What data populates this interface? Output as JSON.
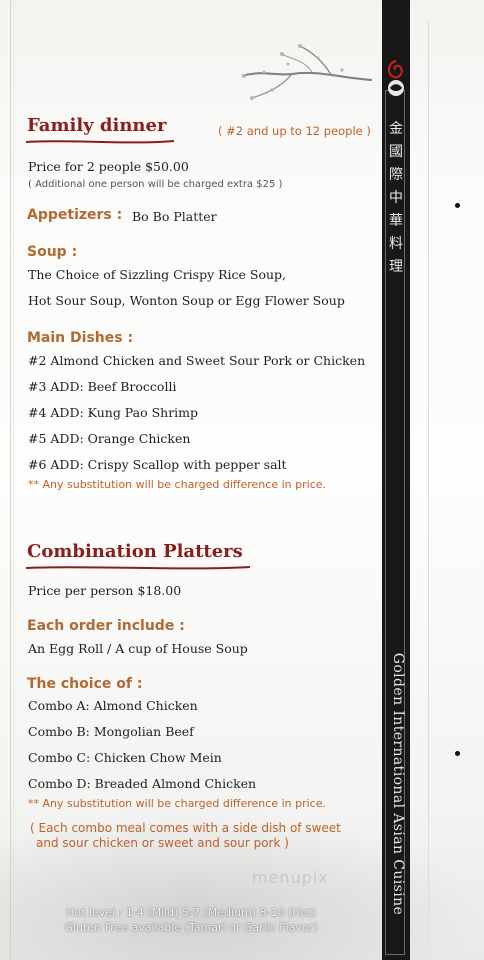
{
  "family": {
    "title": "Family dinner",
    "note": "( #2 and up to 12 people )",
    "price": "Price for 2 people $50.00",
    "additional": "( Additional one person will be charged extra $25 )",
    "appetizers_label": "Appetizers :",
    "appetizers_value": "Bo Bo Platter",
    "soup_label": "Soup :",
    "soup_lines": [
      "The Choice of Sizzling Crispy Rice Soup,",
      "Hot Sour Soup, Wonton Soup or Egg Flower Soup"
    ],
    "main_label": "Main Dishes :",
    "main_lines": [
      "#2 Almond Chicken and Sweet Sour Pork or Chicken",
      "#3 ADD: Beef Broccolli",
      "#4 ADD: Kung Pao Shrimp",
      "#5 ADD: Orange Chicken",
      "#6 ADD: Crispy Scallop with pepper salt"
    ],
    "substitution": "** Any substitution will be charged difference in price."
  },
  "combo": {
    "title": "Combination Platters",
    "price": "Price per person $18.00",
    "each_label": "Each order include :",
    "each_value": "An Egg Roll / A cup of  House Soup",
    "choice_label": "The choice of :",
    "choices": [
      "Combo A: Almond Chicken",
      "Combo B: Mongolian Beef",
      "Combo C: Chicken Chow Mein",
      "Combo D: Breaded Almond Chicken"
    ],
    "substitution": "** Any substitution will be charged difference in price.",
    "side_note_1": "( Each combo meal comes with a side dish of sweet",
    "side_note_2": "and sour chicken or sweet and sour pork )"
  },
  "footer": {
    "line1": "Hot level : 1-4 (Mild) 5-7 (Medium) 8-10 (Hot)",
    "line2": "Gluten Free available (Tamari or Garlic Flavor)"
  },
  "brand": {
    "chinese_name": [
      "金",
      "國",
      "際",
      "中",
      "華",
      "料",
      "理"
    ],
    "english_name": "Golden International Asian Cuisine",
    "watermark": "menupix"
  },
  "colors": {
    "title_red": "#8a1d1d",
    "subhead_brown": "#b26a33",
    "note_orange": "#c0612a",
    "strip_black": "#181818"
  }
}
